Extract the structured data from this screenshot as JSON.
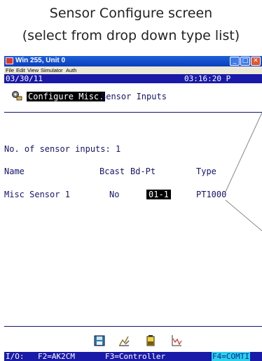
{
  "caption": {
    "line1": "Sensor Configure screen",
    "line2": "(select from drop down type list)"
  },
  "window": {
    "title": "Win 255, Unit 0",
    "controls": {
      "minimize": "_",
      "maximize": "□",
      "close": "✕"
    },
    "menu": [
      "File",
      "Edit",
      "View",
      "Simulator",
      "Auth"
    ]
  },
  "status": {
    "date": "03/30/11",
    "time": "03:16:20 P"
  },
  "header": {
    "icon": "gear-sensor-icon",
    "title_highlight": "Configure Misc.",
    "title_rest": "Sensor Inputs"
  },
  "sensors": {
    "count_label": "No. of sensor inputs: 1",
    "columns": {
      "name": "Name",
      "bcast": "Bcast",
      "bdpt": "Bd-Pt",
      "type": "Type"
    },
    "rows": [
      {
        "name": "Misc Sensor 1",
        "bcast": "No",
        "bdpt": "01-1",
        "type": "PT1000"
      }
    ]
  },
  "toolbar": {
    "icons": [
      "save-disk-icon",
      "chart-edit-icon",
      "battery-icon",
      "graph-icon"
    ]
  },
  "fkeys": {
    "io": "I/O:",
    "f2": "F2=AK2CM",
    "f3": "F3=Controller",
    "f4": "F4=COMTI"
  },
  "colors": {
    "status_bg": "#1a1aa8",
    "text": "#14146e",
    "highlight_bg": "#000000",
    "fkey_active_bg": "#2ad1e6"
  }
}
